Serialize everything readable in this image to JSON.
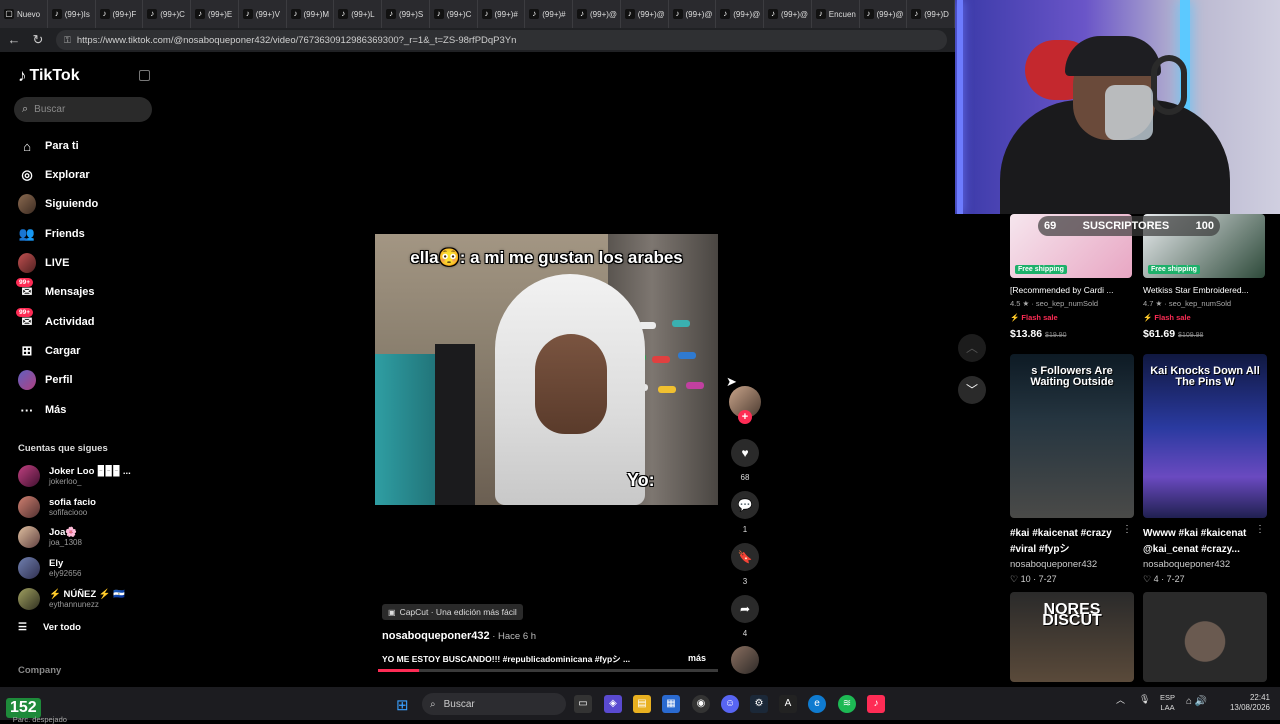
{
  "browser": {
    "tabs": [
      "Nuevo",
      "(99+)Is",
      "(99+)F",
      "(99+)C",
      "(99+)E",
      "(99+)V",
      "(99+)M",
      "(99+)L",
      "(99+)S",
      "(99+)C",
      "(99+)#",
      "(99+)#",
      "(99+)@",
      "(99+)@",
      "(99+)@",
      "(99+)@",
      "(99+)@",
      "Encuen",
      "(99+)@",
      "(99+)D"
    ],
    "url": "https://www.tiktok.com/@nosaboqueponer432/video/7673630912986369300?_r=1&_t=ZS-98rfPDqP3Yn"
  },
  "sidebar": {
    "logo": "TikTok",
    "search_placeholder": "Buscar",
    "nav": [
      {
        "label": "Para ti",
        "icon": "home-icon"
      },
      {
        "label": "Explorar",
        "icon": "compass-icon"
      },
      {
        "label": "Siguiendo",
        "icon": "avatar"
      },
      {
        "label": "Friends",
        "icon": "friends-icon"
      },
      {
        "label": "LIVE",
        "icon": "live-icon"
      },
      {
        "label": "Mensajes",
        "icon": "message-icon",
        "badge": "99+"
      },
      {
        "label": "Actividad",
        "icon": "inbox-icon",
        "badge": "99+"
      },
      {
        "label": "Cargar",
        "icon": "upload-icon"
      },
      {
        "label": "Perfil",
        "icon": "profile-icon"
      },
      {
        "label": "Más",
        "icon": "more-icon"
      }
    ],
    "following_title": "Cuentas que sigues",
    "accounts": [
      {
        "name": "Joker Loo 🁢🁢🁢 ...",
        "handle": "jokerloo_"
      },
      {
        "name": "sofia facio",
        "handle": "sofifaciooo"
      },
      {
        "name": "Joa🌸",
        "handle": "joa_1308"
      },
      {
        "name": "Ely",
        "handle": "ely92656"
      },
      {
        "name": "⚡ NÚÑEZ ⚡ 🇸🇻",
        "handle": "eythannunezz"
      }
    ],
    "see_all": "Ver todo",
    "company": "Company"
  },
  "video": {
    "caption_top": "ella😳: a mi me gustan los arabes",
    "caption_bottom": "Yo:",
    "capcut": "CapCut · Una edición más fácil",
    "author": "nosaboqueponer432",
    "time": " · Hace 6 h",
    "description": "YO ME ESTOY BUSCANDO!!! #republicadominicana #fypシ ...",
    "more": "más",
    "progress": 0.12,
    "likes": "68",
    "comments": "1",
    "saves": "3",
    "shares": "4"
  },
  "right_panel": {
    "subs_left": "69",
    "subs_label": "SUSCRIPTORES",
    "subs_right": "100",
    "products": [
      {
        "badge": "Free shipping",
        "title": "[Recommended by Cardi ...",
        "rating": "4.5 ★ · seo_kep_numSold",
        "flash": "⚡ Flash sale",
        "price": "$13.86",
        "old": "$19.90"
      },
      {
        "badge": "Free shipping",
        "title": "Wetkiss Star Embroidered...",
        "rating": "4.7 ★ · seo_kep_numSold",
        "flash": "⚡ Flash sale",
        "price": "$61.69",
        "old": "$109.98"
      }
    ],
    "videos": [
      {
        "overlay": "s Followers Are Waiting Outside",
        "caption": "#kai #kaicenat #crazy #viral #fypシ",
        "author": "nosaboqueponer432",
        "meta": "♡ 10 · 7-27"
      },
      {
        "overlay": "Kai Knocks Down All The Pins W",
        "caption": "Wwww #kai #kaicenat @kai_cenat #crazy...",
        "author": "nosaboqueponer432",
        "meta": "♡ 4 · 7-27"
      },
      {
        "overlay": "NORES DISCUT",
        "caption": "",
        "author": "",
        "meta": ""
      },
      {
        "overlay": "",
        "caption": "",
        "author": "",
        "meta": ""
      }
    ]
  },
  "taskbar": {
    "weather_value": "152",
    "weather_text": "Parc. despejado",
    "search": "Buscar",
    "lang": [
      "ESP",
      "LAA"
    ],
    "time": "22:41",
    "date": "13/08/2026"
  },
  "colors": {
    "accent": "#fe2c55",
    "free_shipping": "#1db06a"
  }
}
